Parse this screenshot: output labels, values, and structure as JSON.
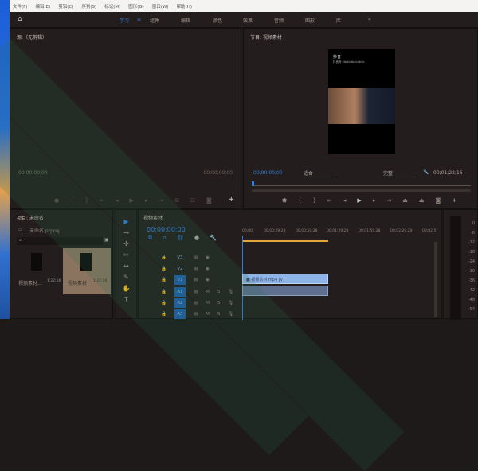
{
  "menu": [
    "文件(F)",
    "编辑(E)",
    "剪辑(C)",
    "序列(S)",
    "标记(M)",
    "图形(G)",
    "窗口(W)",
    "帮助(H)"
  ],
  "workspaces": {
    "home_icon": "home-icon",
    "items": [
      "学习",
      "组件",
      "编辑",
      "颜色",
      "效果",
      "音频",
      "图形",
      "库"
    ],
    "active": "学习",
    "more": "»"
  },
  "source": {
    "title": "源:（无剪辑）",
    "timecode_in": "00;00;00;00",
    "timecode_out": "00;00;00;00"
  },
  "program": {
    "title": "节目: 视频素材",
    "timecode": "00;00;00;00",
    "fit": "适合",
    "quality": "完整",
    "duration": "00;01;22;16",
    "video_overlay": {
      "app": "抖音",
      "id": "抖音号: 4b4b4b4b4b4b"
    }
  },
  "project": {
    "title": "项目: 未命名",
    "file": "未命名.prproj",
    "items": [
      {
        "name": "视频素材...",
        "duration": "1:22:16"
      },
      {
        "name": "视频素材",
        "duration": "1:22:16"
      }
    ]
  },
  "timeline": {
    "title": "视频素材",
    "timecode": "00;00;00;00",
    "ruler": [
      "00;00",
      "00;00;29;29",
      "00;00;59;28",
      "00;01;29;29",
      "00;01;59;28",
      "00;02;29;29",
      "00;02;5"
    ],
    "tracks": [
      {
        "name": "V3",
        "type": "video",
        "target": false
      },
      {
        "name": "V2",
        "type": "video",
        "target": false
      },
      {
        "name": "V1",
        "type": "video",
        "target": true
      },
      {
        "name": "A1",
        "type": "audio",
        "target": true
      },
      {
        "name": "A2",
        "type": "audio",
        "target": true
      },
      {
        "name": "A3",
        "type": "audio",
        "target": true
      }
    ],
    "clip_video": "视频素材.mp4 [V]"
  },
  "meter": [
    "0",
    "-6",
    "-12",
    "-18",
    "-24",
    "-30",
    "-36",
    "-42",
    "-48",
    "-54"
  ],
  "colors": {
    "accent": "#2f7de0",
    "clip": "#8fb4e8",
    "playhead_range": "#e3a83a"
  }
}
